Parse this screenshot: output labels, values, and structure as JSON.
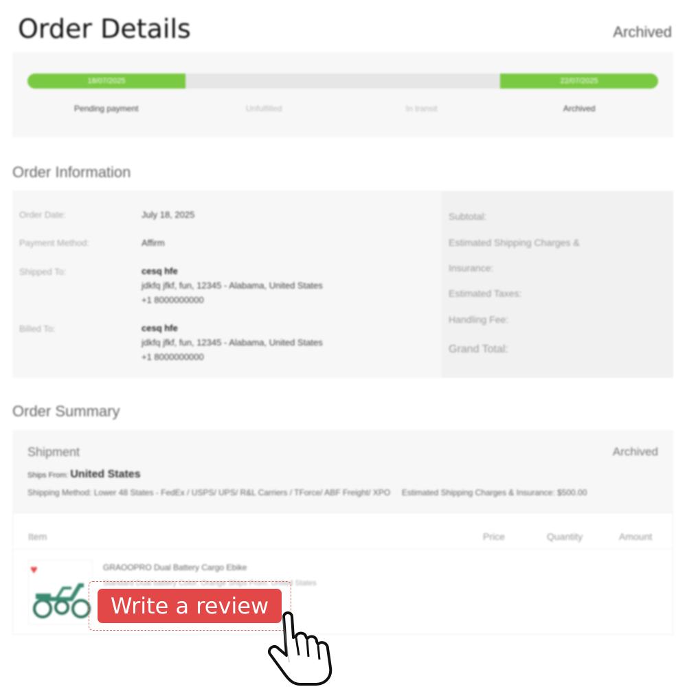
{
  "header": {
    "title": "Order Details",
    "status": "Archived"
  },
  "progress": {
    "start_date": "18/07/2025",
    "end_date": "22/07/2025",
    "steps": [
      "Pending payment",
      "Unfulfilled",
      "In transit",
      "Archived"
    ]
  },
  "order_info": {
    "title": "Order Information",
    "order_date_label": "Order Date:",
    "order_date": "July 18, 2025",
    "payment_label": "Payment Method:",
    "payment": "Affirm",
    "shipped_label": "Shipped To:",
    "shipped_name": "cesq hfe",
    "shipped_addr": "jdkfq jfkf, fun, 12345 - Alabama, United States",
    "shipped_phone": "+1 8000000000",
    "billed_label": "Billed To:",
    "billed_name": "cesq hfe",
    "billed_addr": "jdkfq jfkf, fun, 12345 - Alabama, United States",
    "billed_phone": "+1 8000000000",
    "subtotal_label": "Subtotal:",
    "shipping_label_1": "Estimated Shipping Charges &",
    "shipping_label_2": "Insurance:",
    "taxes_label": "Estimated Taxes:",
    "handling_label": "Handling Fee:",
    "grand_total_label": "Grand Total:"
  },
  "summary": {
    "title": "Order Summary",
    "shipment_label": "Shipment",
    "shipment_status": "Archived",
    "ships_from_label": "Ships From:",
    "ships_from": "United States",
    "shipping_method": "Shipping Method: Lower 48 States - FedEx / USPS/ UPS/ R&L Carriers / TForce/ ABF Freight/ XPO",
    "shipping_charges": "Estimated Shipping Charges & Insurance: $500.00",
    "columns": [
      "Item",
      "Price",
      "Quantity",
      "Amount"
    ],
    "item_name": "GRAOOPRO Dual Battery Cargo Ebike",
    "item_specs": "Standard Dual battery   Color: Orange   Ships From: United States"
  },
  "review_button": {
    "label": "Write a review"
  },
  "colors": {
    "accent_green": "#7ac943",
    "review_red": "#e34848"
  }
}
